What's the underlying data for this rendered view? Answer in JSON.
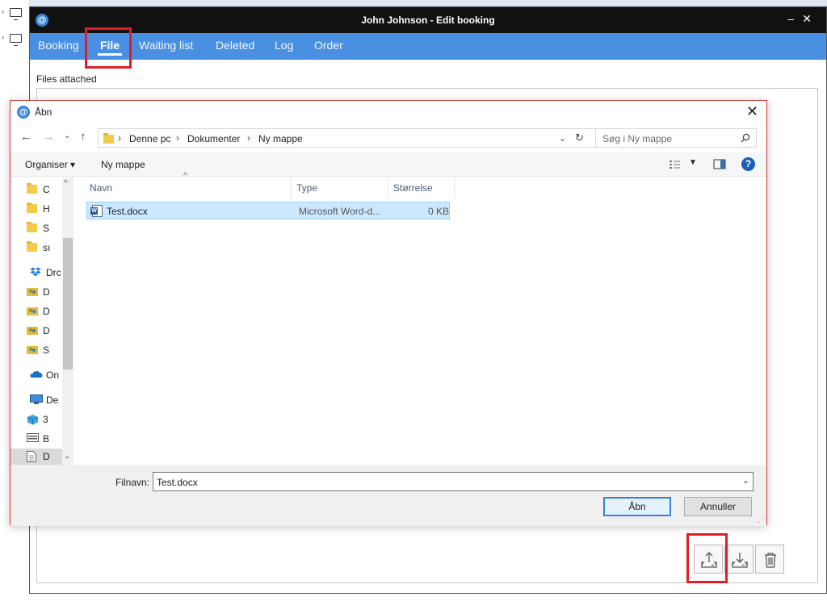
{
  "window": {
    "title": "John Johnson - Edit booking",
    "logo_glyph": "@",
    "minimize_glyph": "–",
    "close_glyph": "✕"
  },
  "menu": {
    "tabs": [
      {
        "label": "Booking"
      },
      {
        "label": "File"
      },
      {
        "label": "Waiting list"
      },
      {
        "label": "Deleted"
      },
      {
        "label": "Log"
      },
      {
        "label": "Order"
      }
    ],
    "active": "File"
  },
  "files_section": {
    "label": "Files attached"
  },
  "dialog": {
    "title": "Åbn",
    "breadcrumb": [
      "Denne pc",
      "Dokumenter",
      "Ny mappe"
    ],
    "search_placeholder": "Søg i Ny mappe",
    "toolbar": {
      "organize": "Organiser ▾",
      "new_folder": "Ny mappe"
    },
    "nav_items": [
      {
        "label": "C",
        "icon": "folder-icon"
      },
      {
        "label": "H",
        "icon": "folder-icon"
      },
      {
        "label": "S",
        "icon": "folder-icon"
      },
      {
        "label": "sı",
        "icon": "folder-icon"
      },
      {
        "label": "Drc",
        "icon": "dropbox-icon"
      },
      {
        "label": "D",
        "icon": "shared-folder-icon"
      },
      {
        "label": "D",
        "icon": "shared-folder-icon"
      },
      {
        "label": "D",
        "icon": "shared-folder-icon"
      },
      {
        "label": "S",
        "icon": "shared-folder-icon"
      },
      {
        "label": "On",
        "icon": "onedrive-icon"
      },
      {
        "label": "De",
        "icon": "computer-icon"
      },
      {
        "label": "3",
        "icon": "3d-objects-icon"
      },
      {
        "label": "B",
        "icon": "desktop-icon"
      },
      {
        "label": "D",
        "icon": "documents-icon"
      }
    ],
    "columns": {
      "name": "Navn",
      "type": "Type",
      "size": "Størrelse"
    },
    "files": [
      {
        "name": "Test.docx",
        "type": "Microsoft Word-d...",
        "size": "0 KB"
      }
    ],
    "filename_label": "Filnavn:",
    "filename_value": "Test.docx",
    "open_button": "Åbn",
    "cancel_button": "Annuller"
  },
  "colors": {
    "menubar": "#4a90e2",
    "titlebar": "#111111",
    "highlight": "#e21d2a"
  }
}
